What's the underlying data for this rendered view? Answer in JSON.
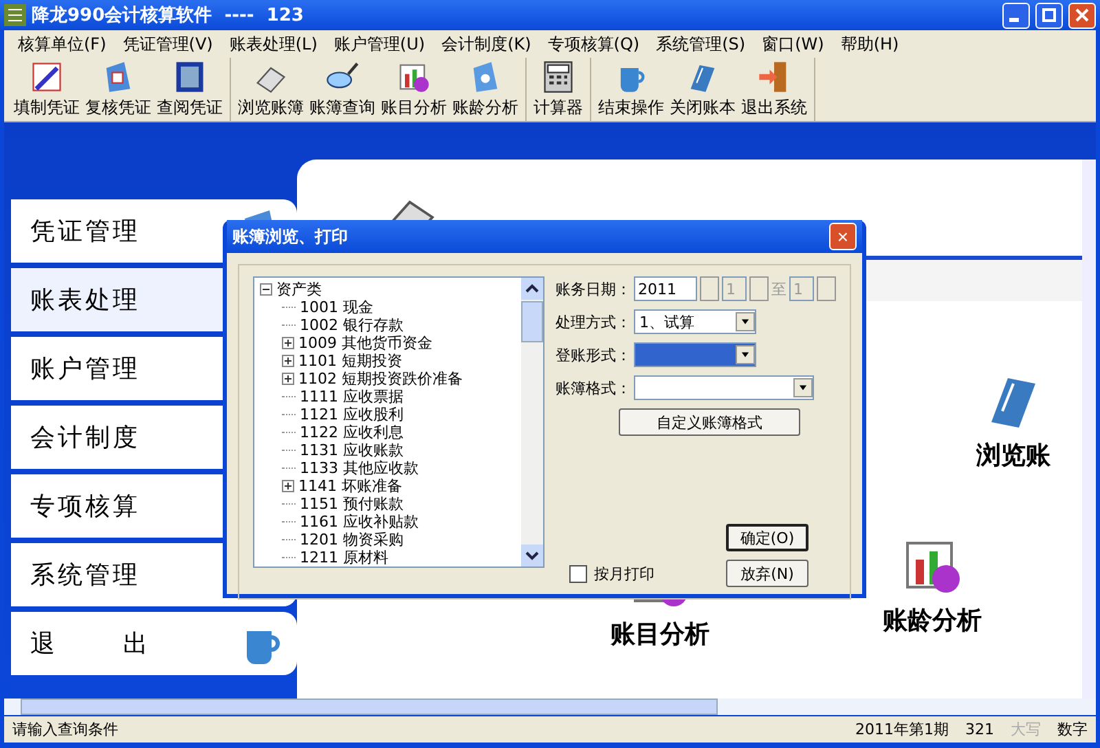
{
  "window": {
    "title": "降龙990会计核算软件  ----  123"
  },
  "menu": [
    "核算单位(F)",
    "凭证管理(V)",
    "账表处理(L)",
    "账户管理(U)",
    "会计制度(K)",
    "专项核算(Q)",
    "系统管理(S)",
    "窗口(W)",
    "帮助(H)"
  ],
  "toolbar": [
    {
      "buttons": [
        "填制凭证",
        "复核凭证",
        "查阅凭证"
      ]
    },
    {
      "buttons": [
        "浏览账簿",
        "账簿查询",
        "账目分析",
        "账龄分析"
      ]
    },
    {
      "buttons": [
        "计算器"
      ]
    },
    {
      "buttons": [
        "结束操作",
        "关闭账本",
        "退出系统"
      ]
    }
  ],
  "nav": [
    {
      "label": "凭证管理",
      "selected": false
    },
    {
      "label": "账表处理",
      "selected": true
    },
    {
      "label": "账户管理",
      "selected": false
    },
    {
      "label": "会计制度",
      "selected": false
    },
    {
      "label": "专项核算",
      "selected": false
    },
    {
      "label": "系统管理",
      "selected": false
    },
    {
      "label": "退 出",
      "selected": false
    }
  ],
  "panel": {
    "launchers": [
      "浏览账",
      "账目分析",
      "账龄分析"
    ]
  },
  "dialog": {
    "title": "账簿浏览、打印",
    "tree": {
      "label": "资产类",
      "expanded": true,
      "children": [
        {
          "label": "1001 现金",
          "expandable": false
        },
        {
          "label": "1002 银行存款",
          "expandable": false
        },
        {
          "label": "1009 其他货币资金",
          "expandable": true
        },
        {
          "label": "1101 短期投资",
          "expandable": true
        },
        {
          "label": "1102 短期投资跌价准备",
          "expandable": true
        },
        {
          "label": "1111 应收票据",
          "expandable": false
        },
        {
          "label": "1121 应收股利",
          "expandable": false
        },
        {
          "label": "1122 应收利息",
          "expandable": false
        },
        {
          "label": "1131 应收账款",
          "expandable": false
        },
        {
          "label": "1133 其他应收款",
          "expandable": false
        },
        {
          "label": "1141 坏账准备",
          "expandable": true
        },
        {
          "label": "1151 预付账款",
          "expandable": false
        },
        {
          "label": "1161 应收补贴款",
          "expandable": false
        },
        {
          "label": "1201 物资采购",
          "expandable": false
        },
        {
          "label": "1211 原材料",
          "expandable": false
        }
      ]
    },
    "date": {
      "label": "账务日期：",
      "year": "2011",
      "from": "1",
      "to_label": "至",
      "to": "1",
      "months_disabled": true
    },
    "fields": [
      {
        "label": "处理方式：",
        "value": "1、试算",
        "selected": false,
        "wide": false
      },
      {
        "label": "登账形式：",
        "selected": true,
        "wide": false
      },
      {
        "label": "账簿格式：",
        "selected": false,
        "wide": true
      }
    ],
    "custom_button": "自定义账簿格式",
    "ok_button": "确定(O)",
    "cancel_button": "放弃(N)",
    "monthly_print": {
      "label": "按月打印",
      "checked": false
    },
    "close": "×"
  },
  "status_bar": [
    {
      "text": "请输入查询条件",
      "disabled": false
    },
    {
      "text": "2011年第1期",
      "disabled": false
    },
    {
      "text": "321",
      "disabled": false
    },
    {
      "text": "大写",
      "disabled": true
    },
    {
      "text": "数字",
      "disabled": false
    }
  ]
}
